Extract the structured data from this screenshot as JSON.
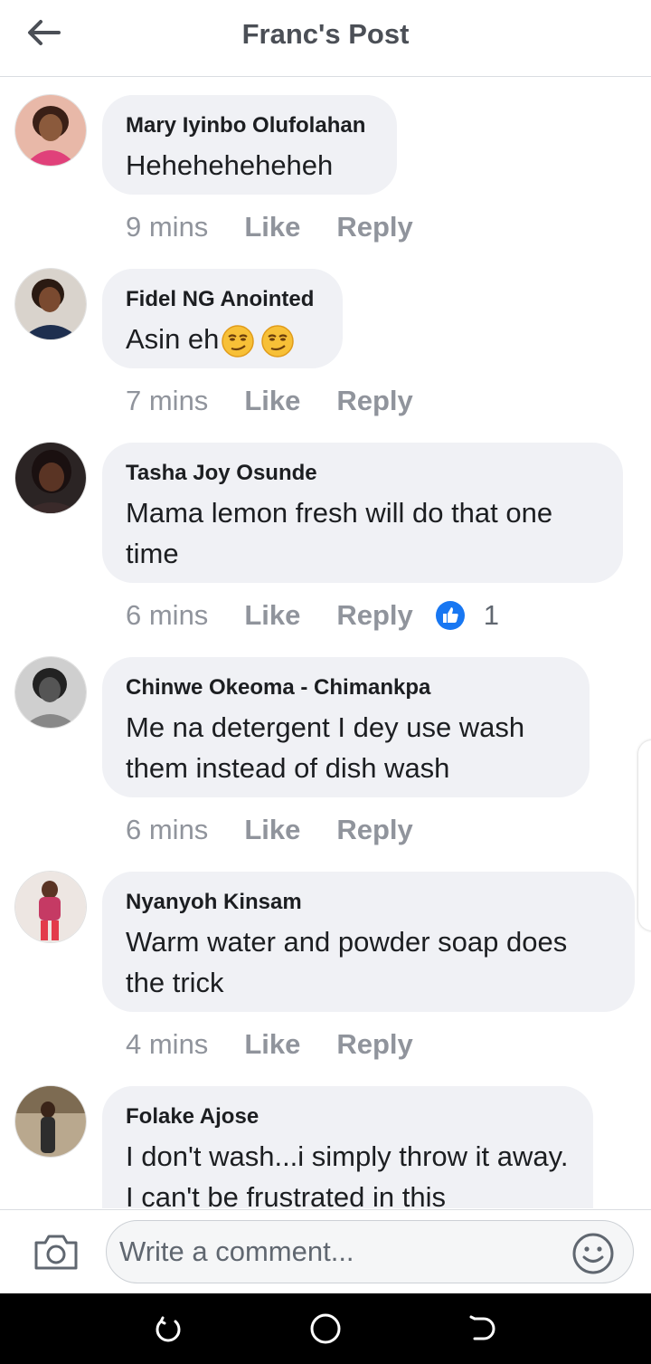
{
  "header": {
    "title": "Franc's Post"
  },
  "comments": [
    {
      "author": "Mary Iyinbo Olufolahan",
      "text": "Heheheheheheh",
      "time": "9 mins",
      "like": "Like",
      "reply": "Reply"
    },
    {
      "author": "Fidel NG Anointed",
      "text": "Asin eh",
      "time": "7 mins",
      "like": "Like",
      "reply": "Reply",
      "emoji": "smirking-face-icon"
    },
    {
      "author": "Tasha Joy Osunde",
      "text": "Mama lemon fresh will do that one time",
      "time": "6 mins",
      "like": "Like",
      "reply": "Reply",
      "reactions": "1"
    },
    {
      "author": "Chinwe Okeoma - Chimankpa",
      "text": "Me na detergent  I dey use wash them instead of dish wash",
      "time": "6 mins",
      "like": "Like",
      "reply": "Reply"
    },
    {
      "author": "Nyanyoh Kinsam",
      "text": "Warm water and powder soap does the trick",
      "time": "4 mins",
      "like": "Like",
      "reply": "Reply"
    },
    {
      "author": "Folake Ajose",
      "text": "I don't wash...i simply throw it away. I can't be frustrated in this"
    }
  ],
  "composer": {
    "placeholder": "Write a comment..."
  },
  "colors": {
    "bubble": "#f0f1f5",
    "meta": "#90949c",
    "like_blue": "#1877f2",
    "header_text": "#4b4f56"
  }
}
